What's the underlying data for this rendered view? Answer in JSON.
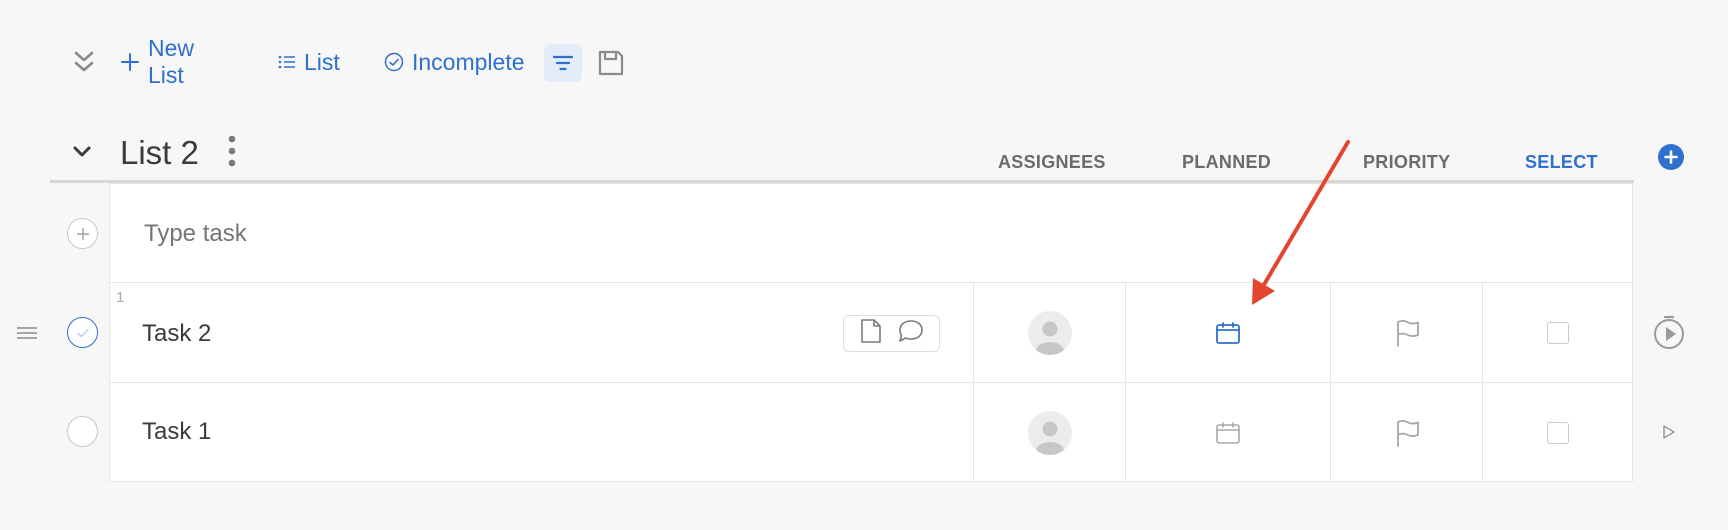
{
  "toolbar": {
    "new_list_label": "New List",
    "list_label": "List",
    "incomplete_label": "Incomplete"
  },
  "list": {
    "title": "List 2",
    "columns": {
      "assignees": "ASSIGNEES",
      "planned": "PLANNED",
      "priority": "PRIORITY",
      "select": "SELECT"
    }
  },
  "new_task": {
    "placeholder": "Type task"
  },
  "tasks": [
    {
      "number": "1",
      "name": "Task 2",
      "completed_state": "hover",
      "planned_highlight": true
    },
    {
      "number": "",
      "name": "Task 1",
      "completed_state": "none",
      "planned_highlight": false
    }
  ],
  "colors": {
    "accent": "#2f6fcd",
    "annotation_arrow": "#e4452f",
    "icon_gray": "#a8a8a8"
  },
  "icons": [
    "chevrons-down-icon",
    "plus-icon",
    "list-icon",
    "check-circle-icon",
    "filter-icon",
    "save-icon",
    "chevron-down-icon",
    "more-vertical-icon",
    "plus-circle-icon",
    "drag-handle-icon",
    "note-icon",
    "comment-icon",
    "avatar-icon",
    "calendar-icon",
    "flag-icon",
    "checkbox-icon",
    "timer-icon",
    "play-icon"
  ]
}
